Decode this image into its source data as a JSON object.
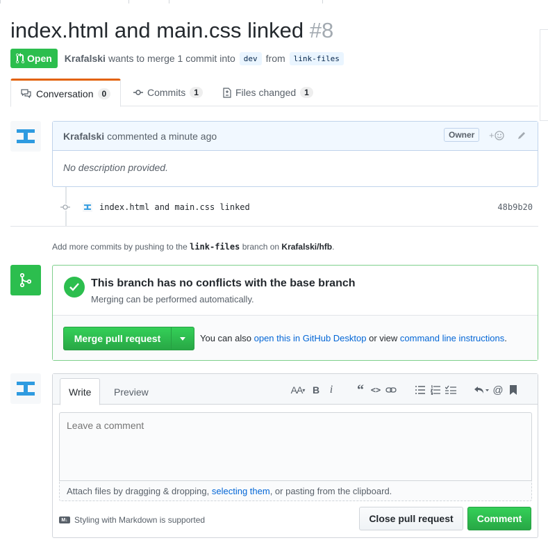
{
  "pr": {
    "title": "index.html and main.css linked",
    "number": "#8",
    "state": "Open",
    "author": "Krafalski",
    "merge_text": "wants to merge 1 commit into",
    "base_branch": "dev",
    "from_text": "from",
    "head_branch": "link-files"
  },
  "tabs": [
    {
      "label": "Conversation",
      "count": "0"
    },
    {
      "label": "Commits",
      "count": "1"
    },
    {
      "label": "Files changed",
      "count": "1"
    }
  ],
  "comment": {
    "author": "Krafalski",
    "action": "commented a minute ago",
    "owner_label": "Owner",
    "body": "No description provided."
  },
  "commit": {
    "message": "index.html and main.css linked",
    "sha": "48b9b20"
  },
  "add_commits": {
    "prefix": "Add more commits by pushing to the",
    "branch": "link-files",
    "middle": "branch on",
    "repo": "Krafalski/hfb",
    "suffix": "."
  },
  "merge": {
    "title": "This branch has no conflicts with the base branch",
    "subtitle": "Merging can be performed automatically.",
    "button_label": "Merge pull request",
    "alt_prefix": "You can also",
    "alt_link1": "open this in GitHub Desktop",
    "alt_middle": "or view",
    "alt_link2": "command line instructions",
    "alt_suffix": "."
  },
  "editor": {
    "write_tab": "Write",
    "preview_tab": "Preview",
    "placeholder": "Leave a comment",
    "attach_prefix": "Attach files by dragging & dropping,",
    "attach_link": "selecting them",
    "attach_suffix": ", or pasting from the clipboard.",
    "markdown_note": "Styling with Markdown is supported",
    "close_button": "Close pull request",
    "comment_button": "Comment",
    "toolbar": {
      "header": "AA",
      "bold": "B",
      "italic": "i"
    }
  },
  "colors": {
    "green": "#2cbe4e",
    "link": "#0366d6",
    "tab_accent": "#e36209"
  }
}
